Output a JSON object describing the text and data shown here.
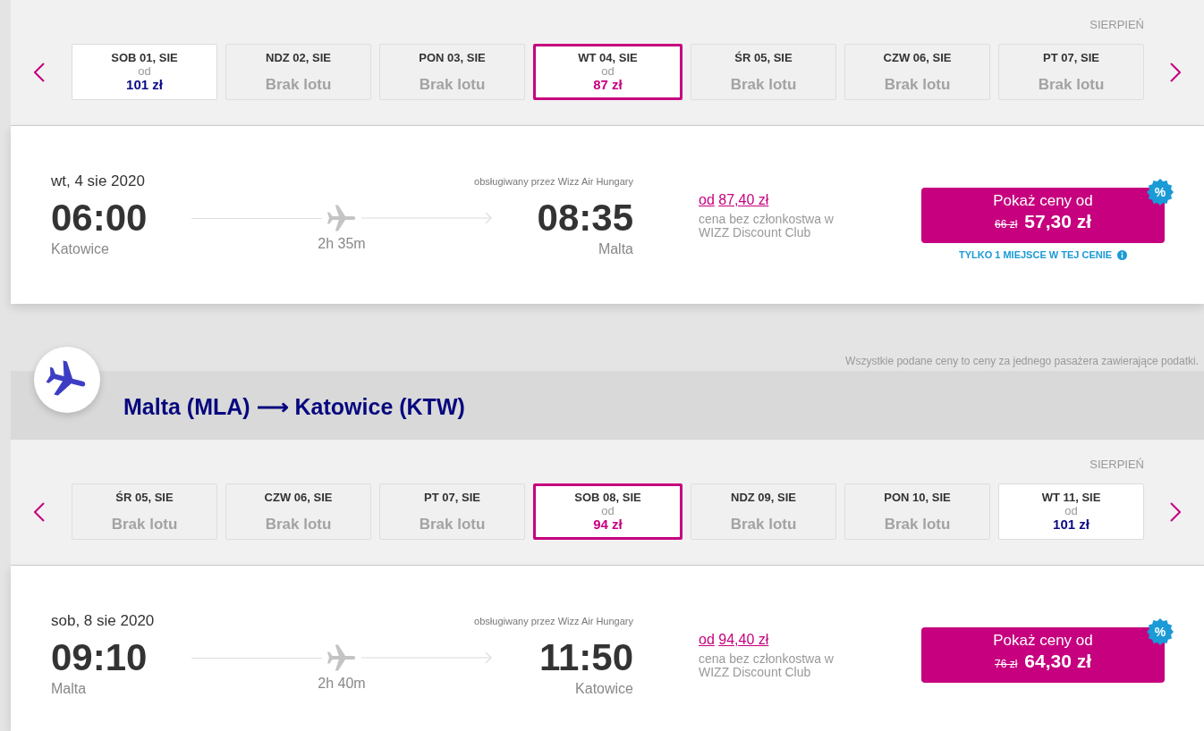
{
  "outbound": {
    "month": "SIERPIEŃ",
    "dates": [
      {
        "day": "SOB 01, SIE",
        "kind": "fare",
        "from": "od",
        "price": "101 zł",
        "selected": false
      },
      {
        "day": "NDZ 02, SIE",
        "kind": "no_flight",
        "status": "Brak lotu",
        "selected": false
      },
      {
        "day": "PON 03, SIE",
        "kind": "no_flight",
        "status": "Brak lotu",
        "selected": false
      },
      {
        "day": "WT 04, SIE",
        "kind": "fare",
        "from": "od",
        "price": "87 zł",
        "selected": true
      },
      {
        "day": "ŚR 05, SIE",
        "kind": "no_flight",
        "status": "Brak lotu",
        "selected": false
      },
      {
        "day": "CZW 06, SIE",
        "kind": "no_flight",
        "status": "Brak lotu",
        "selected": false
      },
      {
        "day": "PT 07, SIE",
        "kind": "no_flight",
        "status": "Brak lotu",
        "selected": false
      }
    ],
    "flight": {
      "date": "wt, 4 sie 2020",
      "operator": "obsługiwany przez Wizz Air Hungary",
      "departure": {
        "time": "06:00",
        "city": "Katowice"
      },
      "duration": "2h 35m",
      "arrival": {
        "time": "08:35",
        "city": "Malta"
      },
      "regular_price": {
        "from": "od",
        "price": "87,40 zł",
        "note": "cena bez członkostwa w WIZZ Discount Club"
      },
      "button": {
        "label": "Pokaż ceny od",
        "old_price": "66 zł",
        "price": "57,30 zł"
      },
      "badge": "%",
      "seats_notice": "TYLKO 1 MIEJSCE W TEJ CENIE"
    }
  },
  "price_note": "Wszystkie podane ceny to ceny za jednego pasażera zawierające podatki.",
  "return": {
    "route": "Malta (MLA) ⟶ Katowice (KTW)",
    "month": "SIERPIEŃ",
    "dates": [
      {
        "day": "ŚR 05, SIE",
        "kind": "no_flight",
        "status": "Brak lotu",
        "selected": false
      },
      {
        "day": "CZW 06, SIE",
        "kind": "no_flight",
        "status": "Brak lotu",
        "selected": false
      },
      {
        "day": "PT 07, SIE",
        "kind": "no_flight",
        "status": "Brak lotu",
        "selected": false
      },
      {
        "day": "SOB 08, SIE",
        "kind": "fare",
        "from": "od",
        "price": "94 zł",
        "selected": true
      },
      {
        "day": "NDZ 09, SIE",
        "kind": "no_flight",
        "status": "Brak lotu",
        "selected": false
      },
      {
        "day": "PON 10, SIE",
        "kind": "no_flight",
        "status": "Brak lotu",
        "selected": false
      },
      {
        "day": "WT 11, SIE",
        "kind": "fare",
        "from": "od",
        "price": "101 zł",
        "selected": false
      }
    ],
    "flight": {
      "date": "sob, 8 sie 2020",
      "operator": "obsługiwany przez Wizz Air Hungary",
      "departure": {
        "time": "09:10",
        "city": "Malta"
      },
      "duration": "2h 40m",
      "arrival": {
        "time": "11:50",
        "city": "Katowice"
      },
      "regular_price": {
        "from": "od",
        "price": "94,40 zł",
        "note": "cena bez członkostwa w WIZZ Discount Club"
      },
      "button": {
        "label": "Pokaż ceny od",
        "old_price": "76 zł",
        "price": "64,30 zł"
      },
      "badge": "%"
    }
  }
}
